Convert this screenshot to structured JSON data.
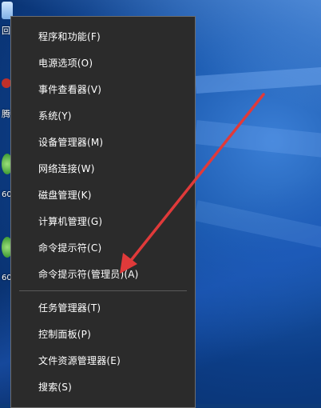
{
  "menu": {
    "items": [
      {
        "label": "程序和功能(F)"
      },
      {
        "label": "电源选项(O)"
      },
      {
        "label": "事件查看器(V)"
      },
      {
        "label": "系统(Y)"
      },
      {
        "label": "设备管理器(M)"
      },
      {
        "label": "网络连接(W)"
      },
      {
        "label": "磁盘管理(K)"
      },
      {
        "label": "计算机管理(G)"
      },
      {
        "label": "命令提示符(C)"
      },
      {
        "label": "命令提示符(管理员)(A)"
      }
    ],
    "items_lower": [
      {
        "label": "任务管理器(T)"
      },
      {
        "label": "控制面板(P)"
      },
      {
        "label": "文件资源管理器(E)"
      },
      {
        "label": "搜索(S)"
      }
    ]
  },
  "desktop_labels": {
    "top": "回",
    "middle": "腾",
    "second": "60",
    "third": "60"
  },
  "colors": {
    "menu_background": "#2b2b2b",
    "menu_border": "#6d6d6d",
    "annotation_arrow": "#e03a3a"
  }
}
